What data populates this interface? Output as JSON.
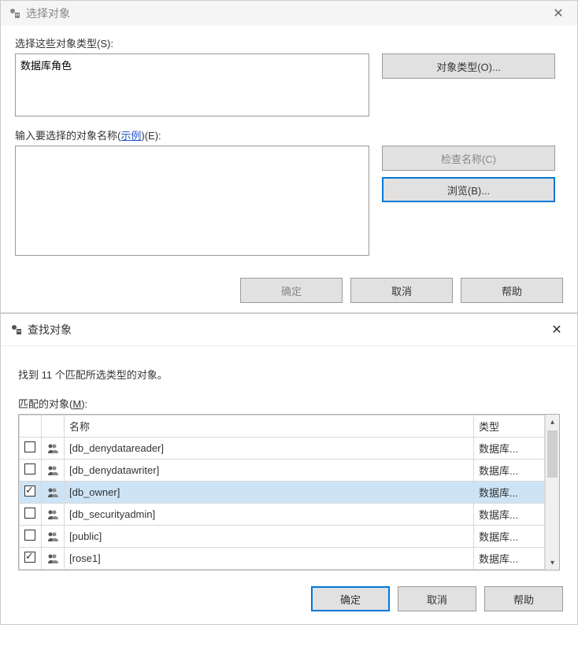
{
  "dialog1": {
    "title": "选择对象",
    "select_types_label": "选择这些对象类型(S):",
    "types_value": "数据库角色",
    "object_types_btn": "对象类型(O)...",
    "enter_names_label_prefix": "输入要选择的对象名称(",
    "example_link": "示例",
    "enter_names_label_suffix": ")(E):",
    "check_names_btn": "检查名称(C)",
    "browse_btn": "浏览(B)...",
    "ok_btn": "确定",
    "cancel_btn": "取消",
    "help_btn": "帮助"
  },
  "dialog2": {
    "title": "查找对象",
    "found_prefix": "找到 ",
    "found_count": "11",
    "found_suffix": " 个匹配所选类型的对象。",
    "matching_label_prefix": "匹配的对象(",
    "matching_hotkey": "M",
    "matching_label_suffix": "):",
    "col_name": "名称",
    "col_type": "类型",
    "rows": [
      {
        "checked": false,
        "name": "[db_denydatareader]",
        "type": "数据库...",
        "selected": false
      },
      {
        "checked": false,
        "name": "[db_denydatawriter]",
        "type": "数据库...",
        "selected": false
      },
      {
        "checked": true,
        "name": "[db_owner]",
        "type": "数据库...",
        "selected": true
      },
      {
        "checked": false,
        "name": "[db_securityadmin]",
        "type": "数据库...",
        "selected": false
      },
      {
        "checked": false,
        "name": "[public]",
        "type": "数据库...",
        "selected": false
      },
      {
        "checked": true,
        "name": "[rose1]",
        "type": "数据库...",
        "selected": false
      }
    ],
    "ok_btn": "确定",
    "cancel_btn": "取消",
    "help_btn": "帮助"
  }
}
